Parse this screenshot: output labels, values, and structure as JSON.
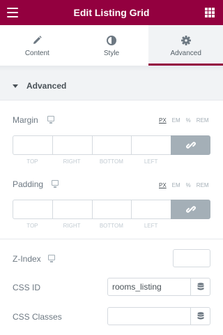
{
  "header": {
    "title": "Edit Listing Grid",
    "menu_icon": "hamburger-menu-icon",
    "apps_icon": "grid-apps-icon",
    "background": "#93003f"
  },
  "tabs": [
    {
      "label": "Content",
      "icon": "pencil-icon",
      "active": false
    },
    {
      "label": "Style",
      "icon": "half-circle-icon",
      "active": false
    },
    {
      "label": "Advanced",
      "icon": "gear-icon",
      "active": true
    }
  ],
  "section": {
    "title": "Advanced",
    "expanded": true
  },
  "margin": {
    "label": "Margin",
    "units": [
      "PX",
      "EM",
      "%",
      "REM"
    ],
    "selected_unit": "PX",
    "sides": [
      "TOP",
      "RIGHT",
      "BOTTOM",
      "LEFT"
    ],
    "values": [
      "",
      "",
      "",
      ""
    ]
  },
  "padding": {
    "label": "Padding",
    "units": [
      "PX",
      "EM",
      "%",
      "REM"
    ],
    "selected_unit": "PX",
    "sides": [
      "TOP",
      "RIGHT",
      "BOTTOM",
      "LEFT"
    ],
    "values": [
      "",
      "",
      "",
      ""
    ]
  },
  "zindex": {
    "label": "Z-Index",
    "value": ""
  },
  "css_id": {
    "label": "CSS ID",
    "value": "rooms_listing"
  },
  "css_classes": {
    "label": "CSS Classes",
    "value": ""
  },
  "colors": {
    "accent": "#93003f",
    "link_button": "#a4afb7"
  }
}
